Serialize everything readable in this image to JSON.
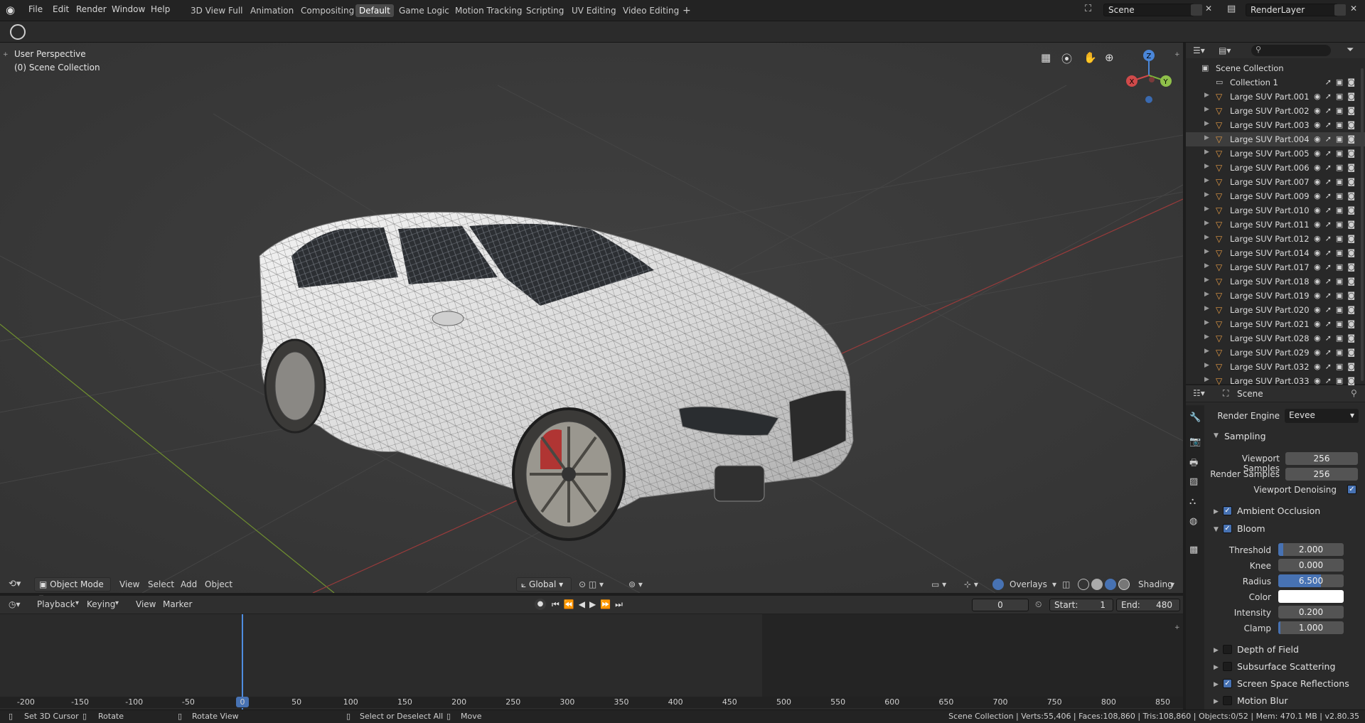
{
  "topbar": {
    "menus": [
      "File",
      "Edit",
      "Render",
      "Window",
      "Help"
    ],
    "workspaces": [
      "3D View Full",
      "Animation",
      "Compositing",
      "Default",
      "Game Logic",
      "Motion Tracking",
      "Scripting",
      "UV Editing",
      "Video Editing"
    ],
    "active_workspace": "Default",
    "add_tab": "+",
    "scene_name": "Scene",
    "view_layer": "RenderLayer"
  },
  "viewport": {
    "perspective_label": "User Perspective",
    "collection_label": "(0) Scene Collection",
    "gizmo": {
      "z": "Z",
      "x": "X",
      "y": "Y"
    },
    "header": {
      "mode": "Object Mode",
      "menus": [
        "View",
        "Select",
        "Add",
        "Object"
      ],
      "orientation": "Global",
      "overlays": "Overlays",
      "shading": "Shading"
    }
  },
  "timeline": {
    "menus": [
      "Playback",
      "Keying",
      "View",
      "Marker"
    ],
    "current_frame": "0",
    "start_label": "Start:",
    "start_value": "1",
    "end_label": "End:",
    "end_value": "480",
    "ruler": [
      "-200",
      "-150",
      "-100",
      "-50",
      "0",
      "50",
      "100",
      "150",
      "200",
      "250",
      "300",
      "350",
      "400",
      "450",
      "500",
      "550",
      "600",
      "650",
      "700",
      "750",
      "800",
      "850"
    ]
  },
  "outliner": {
    "root": "Scene Collection",
    "collection": "Collection 1",
    "items": [
      "Large SUV Part.001",
      "Large SUV Part.002",
      "Large SUV Part.003",
      "Large SUV Part.004",
      "Large SUV Part.005",
      "Large SUV Part.006",
      "Large SUV Part.007",
      "Large SUV Part.009",
      "Large SUV Part.010",
      "Large SUV Part.011",
      "Large SUV Part.012",
      "Large SUV Part.014",
      "Large SUV Part.017",
      "Large SUV Part.018",
      "Large SUV Part.019",
      "Large SUV Part.020",
      "Large SUV Part.021",
      "Large SUV Part.028",
      "Large SUV Part.029",
      "Large SUV Part.032",
      "Large SUV Part.033"
    ],
    "selected": "Large SUV Part.004"
  },
  "properties": {
    "context": "Scene",
    "render_engine_label": "Render Engine",
    "render_engine": "Eevee",
    "sampling": {
      "title": "Sampling",
      "viewport_samples_label": "Viewport Samples",
      "viewport_samples": "256",
      "render_samples_label": "Render Samples",
      "render_samples": "256",
      "viewport_denoising_label": "Viewport Denoising"
    },
    "ambient_occlusion": "Ambient Occlusion",
    "bloom": {
      "title": "Bloom",
      "threshold_label": "Threshold",
      "threshold": "2.000",
      "threshold_fill": 0.08,
      "knee_label": "Knee",
      "knee": "0.000",
      "knee_fill": 0.0,
      "radius_label": "Radius",
      "radius": "6.500",
      "radius_fill": 0.65,
      "color_label": "Color",
      "intensity_label": "Intensity",
      "intensity": "0.200",
      "intensity_fill": 0.0,
      "clamp_label": "Clamp",
      "clamp": "1.000",
      "clamp_fill": 0.03
    },
    "depth_of_field": "Depth of Field",
    "subsurface_scattering": "Subsurface Scattering",
    "screen_space_reflections": "Screen Space Reflections",
    "motion_blur": "Motion Blur"
  },
  "statusbar": {
    "hint1": "Set 3D Cursor",
    "hint2": "Rotate",
    "hint3": "Rotate View",
    "hint4": "Select or Deselect All",
    "hint5": "Move",
    "stats": "Scene Collection | Verts:55,406 | Faces:108,860 | Tris:108,860 | Objects:0/52 | Mem: 470.1 MB | v2.80.35"
  }
}
